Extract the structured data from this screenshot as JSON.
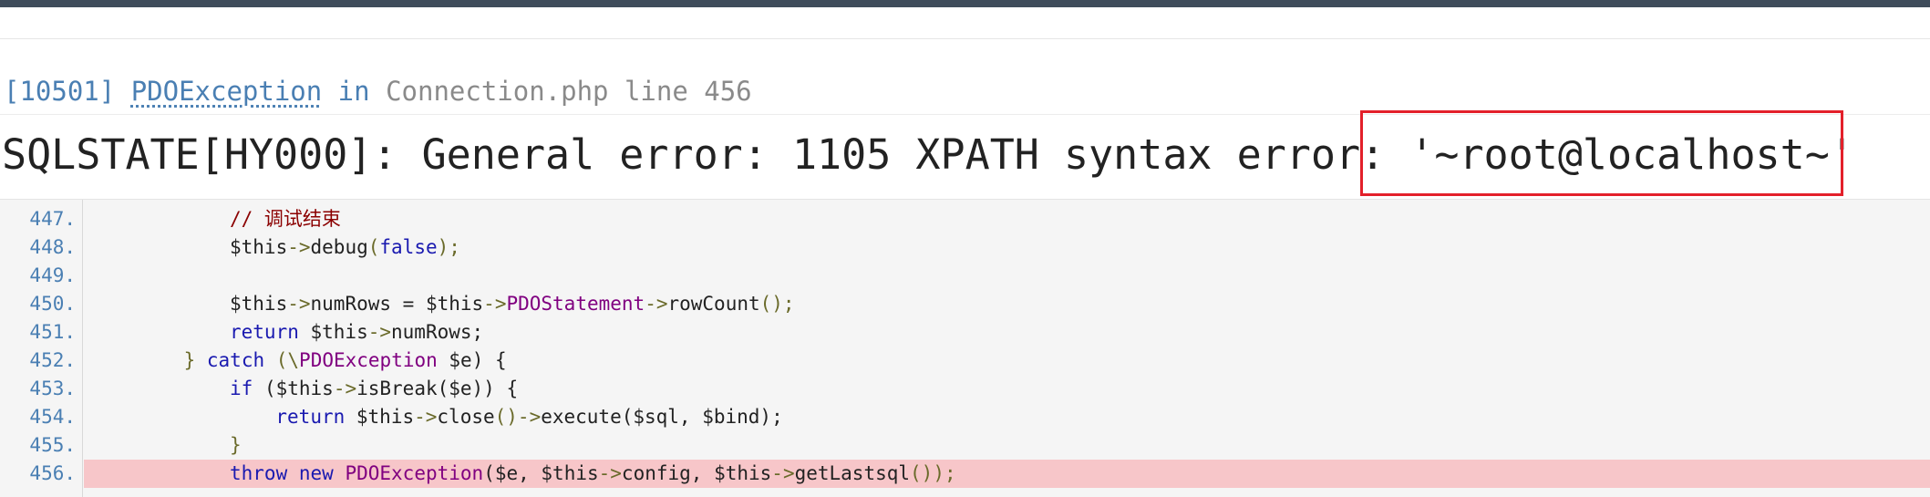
{
  "exception": {
    "code": "[10501]",
    "class": "PDOException",
    "in_word": "in",
    "file": "Connection.php line 456"
  },
  "error": {
    "prefix": "SQLSTATE[HY000]: General error: 1105 XPATH syntax error:",
    "highlighted": " '~root@localhost~'"
  },
  "colors": {
    "top_bar": "#3f4c5b",
    "link_blue": "#4a7fb3",
    "highlight_border": "#e3202a",
    "error_line_bg": "#f7c6c9"
  },
  "code": {
    "lines": [
      {
        "num": "447.",
        "indent": "        ",
        "tokens": [
          {
            "t": "// 调试结束",
            "k": "comment"
          }
        ]
      },
      {
        "num": "448.",
        "indent": "        ",
        "tokens": [
          {
            "t": "$this",
            "k": "plain"
          },
          {
            "t": "->",
            "k": "op"
          },
          {
            "t": "debug",
            "k": "plain"
          },
          {
            "t": "(",
            "k": "op"
          },
          {
            "t": "false",
            "k": "kw"
          },
          {
            "t": ");",
            "k": "op"
          }
        ]
      },
      {
        "num": "449.",
        "indent": "",
        "tokens": []
      },
      {
        "num": "450.",
        "indent": "        ",
        "tokens": [
          {
            "t": "$this",
            "k": "plain"
          },
          {
            "t": "->",
            "k": "op"
          },
          {
            "t": "numRows = $this",
            "k": "plain"
          },
          {
            "t": "->",
            "k": "op"
          },
          {
            "t": "PDOStatement",
            "k": "cls"
          },
          {
            "t": "->",
            "k": "op"
          },
          {
            "t": "rowCount",
            "k": "plain"
          },
          {
            "t": "();",
            "k": "op"
          }
        ]
      },
      {
        "num": "451.",
        "indent": "        ",
        "tokens": [
          {
            "t": "return",
            "k": "kw"
          },
          {
            "t": " $this",
            "k": "plain"
          },
          {
            "t": "->",
            "k": "op"
          },
          {
            "t": "numRows;",
            "k": "plain"
          }
        ]
      },
      {
        "num": "452.",
        "indent": "    ",
        "tokens": [
          {
            "t": "} ",
            "k": "op"
          },
          {
            "t": "catch",
            "k": "kw"
          },
          {
            "t": " (\\",
            "k": "op"
          },
          {
            "t": "PDOException",
            "k": "cls"
          },
          {
            "t": " $e) {",
            "k": "plain"
          }
        ]
      },
      {
        "num": "453.",
        "indent": "        ",
        "tokens": [
          {
            "t": "if",
            "k": "kw"
          },
          {
            "t": " ($this",
            "k": "plain"
          },
          {
            "t": "->",
            "k": "op"
          },
          {
            "t": "isBreak($e)) {",
            "k": "plain"
          }
        ]
      },
      {
        "num": "454.",
        "indent": "            ",
        "tokens": [
          {
            "t": "return",
            "k": "kw"
          },
          {
            "t": " $this",
            "k": "plain"
          },
          {
            "t": "->",
            "k": "op"
          },
          {
            "t": "close",
            "k": "plain"
          },
          {
            "t": "()",
            "k": "op"
          },
          {
            "t": "->",
            "k": "op"
          },
          {
            "t": "execute($sql, $bind);",
            "k": "plain"
          }
        ]
      },
      {
        "num": "455.",
        "indent": "        ",
        "tokens": [
          {
            "t": "}",
            "k": "op"
          }
        ]
      },
      {
        "num": "456.",
        "indent": "",
        "error": true,
        "tokens": [
          {
            "t": "throw",
            "k": "kw"
          },
          {
            "t": " ",
            "k": "plain"
          },
          {
            "t": "new",
            "k": "kw"
          },
          {
            "t": " ",
            "k": "plain"
          },
          {
            "t": "PDOException",
            "k": "cls"
          },
          {
            "t": "($e, $this",
            "k": "plain"
          },
          {
            "t": "->",
            "k": "op"
          },
          {
            "t": "config, $this",
            "k": "plain"
          },
          {
            "t": "->",
            "k": "op"
          },
          {
            "t": "getLastsql",
            "k": "plain"
          },
          {
            "t": "());",
            "k": "op"
          }
        ]
      }
    ]
  }
}
